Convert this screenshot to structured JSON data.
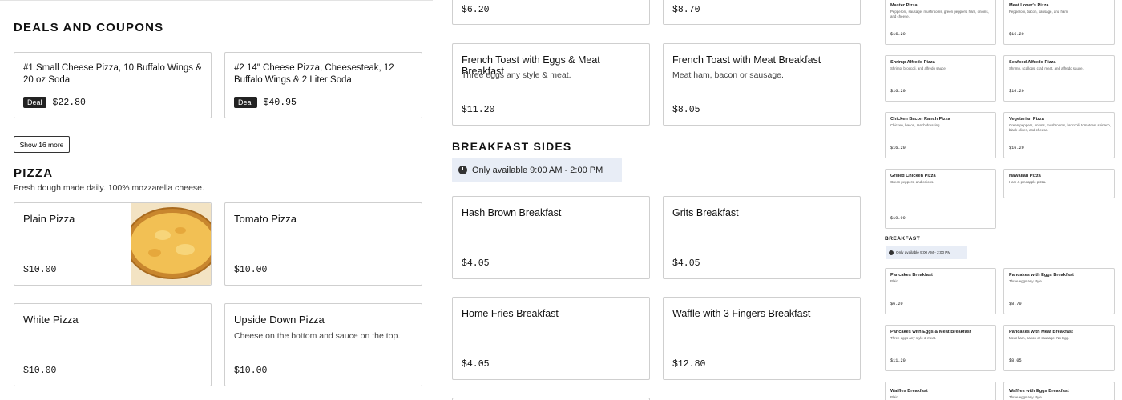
{
  "deals": {
    "title": "Deals and Coupons",
    "items": [
      {
        "name": "#1 Small Cheese Pizza, 10 Buffalo Wings & 20 oz Soda",
        "badge": "Deal",
        "price": "$22.80"
      },
      {
        "name": "#2 14\" Cheese Pizza, Cheesesteak, 12 Buffalo Wings & 2 Liter Soda",
        "badge": "Deal",
        "price": "$40.95"
      }
    ],
    "show_more_label": "Show 16 more"
  },
  "pizza": {
    "title": "Pizza",
    "subtitle": "Fresh dough made daily. 100% mozzarella cheese.",
    "items": [
      {
        "name": "Plain Pizza",
        "desc": "",
        "price": "$10.00"
      },
      {
        "name": "Tomato Pizza",
        "desc": "",
        "price": "$10.00"
      },
      {
        "name": "White Pizza",
        "desc": "",
        "price": "$10.00"
      },
      {
        "name": "Upside Down Pizza",
        "desc": "Cheese on the bottom and sauce on the top.",
        "price": "$10.00"
      }
    ]
  },
  "breakfast_top": {
    "prices_row0": [
      "$6.20",
      "$8.70"
    ],
    "items": [
      {
        "name": "French Toast with Eggs & Meat Breakfast",
        "desc": "Three eggs any style & meat.",
        "price": "$11.20"
      },
      {
        "name": "French Toast with Meat Breakfast",
        "desc": "Meat ham, bacon or sausage.",
        "price": "$8.05"
      }
    ]
  },
  "breakfast_sides": {
    "title": "Breakfast Sides",
    "availability": "Only available 9:00 AM - 2:00 PM",
    "items": [
      {
        "name": "Hash Brown Breakfast",
        "price": "$4.05"
      },
      {
        "name": "Grits Breakfast",
        "price": "$4.05"
      },
      {
        "name": "Home Fries Breakfast",
        "price": "$4.05"
      },
      {
        "name": "Waffle with 3 Fingers Breakfast",
        "price": "$12.80"
      }
    ]
  },
  "small_menu": {
    "pizzas": [
      {
        "name": "Master Pizza",
        "desc": "Pepperoni, sausage, mushrooms, green peppers, ham, onions, and cheese.",
        "price": "$16.20"
      },
      {
        "name": "Meat Lover's Pizza",
        "desc": "Pepperoni, bacon, sausage, and ham.",
        "price": "$16.20"
      },
      {
        "name": "Shrimp Alfredo Pizza",
        "desc": "Shrimp, broccoli, and alfredo sauce.",
        "price": "$16.20"
      },
      {
        "name": "Seafood Alfredo Pizza",
        "desc": "Shrimp, scallops, crab meat, and alfredo sauce.",
        "price": "$16.20"
      },
      {
        "name": "Chicken Bacon Ranch Pizza",
        "desc": "Chicken, bacon, ranch dressing.",
        "price": "$16.20"
      },
      {
        "name": "Vegetarian Pizza",
        "desc": "Green peppers, onions, mushrooms, broccoli, tomatoes, spinach, black olives, and cheese.",
        "price": "$16.20"
      },
      {
        "name": "Grilled Chicken Pizza",
        "desc": "Green peppers, and onions.",
        "price": ""
      },
      {
        "name": "Hawaiian Pizza",
        "desc": "Ham & pineapple pizza.",
        "price": ""
      }
    ],
    "pizza_tail_price": "$19.99",
    "breakfast_title": "Breakfast",
    "breakfast_availability": "Only available 9:00 AM - 2:00 PM",
    "breakfast_items": [
      {
        "name": "Pancakes Breakfast",
        "desc": "Plain.",
        "price": "$6.20"
      },
      {
        "name": "Pancakes with Eggs Breakfast",
        "desc": "Three eggs any style.",
        "price": "$8.70"
      },
      {
        "name": "Pancakes with Eggs & Meat Breakfast",
        "desc": "Three eggs any style & meat.",
        "price": "$11.20"
      },
      {
        "name": "Pancakes with Meat Breakfast",
        "desc": "Meat ham, bacon or sausage. No Egg.",
        "price": "$8.05"
      },
      {
        "name": "Waffles Breakfast",
        "desc": "Plain.",
        "price": ""
      },
      {
        "name": "Waffles with Eggs Breakfast",
        "desc": "Three eggs any style.",
        "price": ""
      }
    ]
  }
}
